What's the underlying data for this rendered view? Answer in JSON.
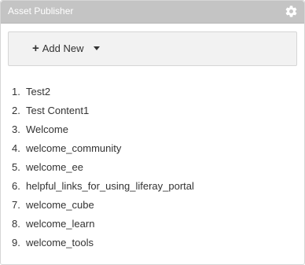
{
  "portlet": {
    "title": "Asset Publisher",
    "icons": {
      "settings": "gear-icon"
    }
  },
  "toolbar": {
    "add_new_label": "Add New",
    "add_icon": "plus-icon",
    "caret_icon": "caret-down-icon"
  },
  "assets": [
    {
      "num": "1.",
      "label": "Test2"
    },
    {
      "num": "2.",
      "label": "Test Content1"
    },
    {
      "num": "3.",
      "label": "Welcome"
    },
    {
      "num": "4.",
      "label": "welcome_community"
    },
    {
      "num": "5.",
      "label": "welcome_ee"
    },
    {
      "num": "6.",
      "label": "helpful_links_for_using_liferay_portal"
    },
    {
      "num": "7.",
      "label": "welcome_cube"
    },
    {
      "num": "8.",
      "label": "welcome_learn"
    },
    {
      "num": "9.",
      "label": "welcome_tools"
    }
  ],
  "colors": {
    "header_bg": "#c4c4c4",
    "toolbar_bg": "#f2f2f2",
    "text": "#333333"
  }
}
